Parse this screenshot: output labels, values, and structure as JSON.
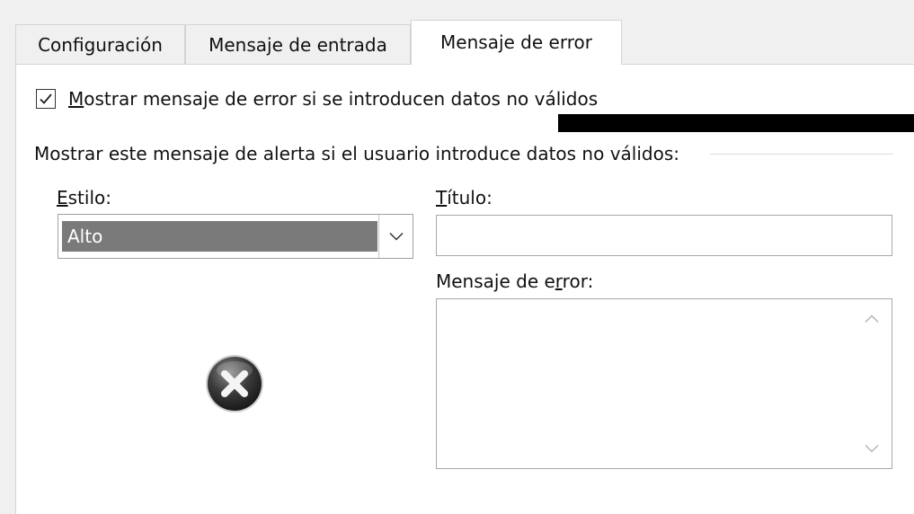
{
  "tabs": [
    {
      "label": "Configuración",
      "active": false
    },
    {
      "label": "Mensaje de entrada",
      "active": false
    },
    {
      "label": "Mensaje de error",
      "active": true
    }
  ],
  "show_error_checkbox": {
    "checked": true,
    "label_mnemonic": "M",
    "label_rest": "ostrar mensaje de error si se introducen datos no válidos"
  },
  "section_heading": "Mostrar este mensaje de alerta si el usuario introduce datos no válidos:",
  "style": {
    "label_mnemonic": "E",
    "label_rest": "stilo:",
    "value": "Alto"
  },
  "title_field": {
    "label_mnemonic": "T",
    "label_rest": "ítulo:",
    "value": ""
  },
  "error_message_field": {
    "label_pre": "Mensaje de e",
    "label_mnemonic": "r",
    "label_post": "ror:",
    "value": ""
  },
  "icons": {
    "checkbox": "checkmark-icon",
    "dropdown": "chevron-down-icon",
    "error": "error-stop-icon",
    "scroll_up": "chevron-up-icon",
    "scroll_down": "chevron-down-icon"
  }
}
